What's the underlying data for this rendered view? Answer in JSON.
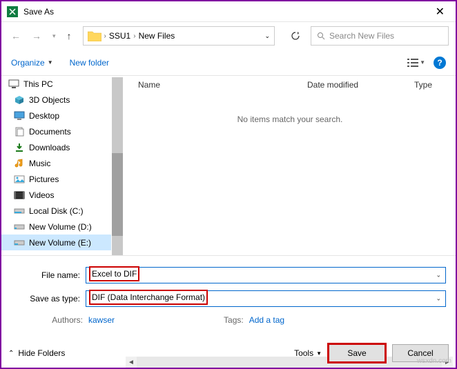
{
  "window": {
    "title": "Save As",
    "close": "✕"
  },
  "breadcrumb": {
    "seg1": "SSU1",
    "seg2": "New Files"
  },
  "search": {
    "placeholder": "Search New Files"
  },
  "toolbar": {
    "organize": "Organize",
    "newfolder": "New folder"
  },
  "tree": {
    "root": "This PC",
    "items": [
      {
        "label": "3D Objects",
        "icon": "cube"
      },
      {
        "label": "Desktop",
        "icon": "desktop"
      },
      {
        "label": "Documents",
        "icon": "doc"
      },
      {
        "label": "Downloads",
        "icon": "download"
      },
      {
        "label": "Music",
        "icon": "music"
      },
      {
        "label": "Pictures",
        "icon": "pic"
      },
      {
        "label": "Videos",
        "icon": "video"
      },
      {
        "label": "Local Disk (C:)",
        "icon": "disk"
      },
      {
        "label": "New Volume (D:)",
        "icon": "disk"
      },
      {
        "label": "New Volume (E:)",
        "icon": "disk"
      }
    ]
  },
  "columns": {
    "name": "Name",
    "date": "Date modified",
    "type": "Type"
  },
  "empty": "No items match your search.",
  "form": {
    "filename_label": "File name:",
    "filename_value": "Excel to DIF",
    "savetype_label": "Save as type:",
    "savetype_value": "DIF (Data Interchange Format)",
    "authors_label": "Authors:",
    "authors_value": "kawser",
    "tags_label": "Tags:",
    "tags_value": "Add a tag"
  },
  "footer": {
    "hide": "Hide Folders",
    "tools": "Tools",
    "save": "Save",
    "cancel": "Cancel"
  },
  "watermark": "wsxdn.com"
}
